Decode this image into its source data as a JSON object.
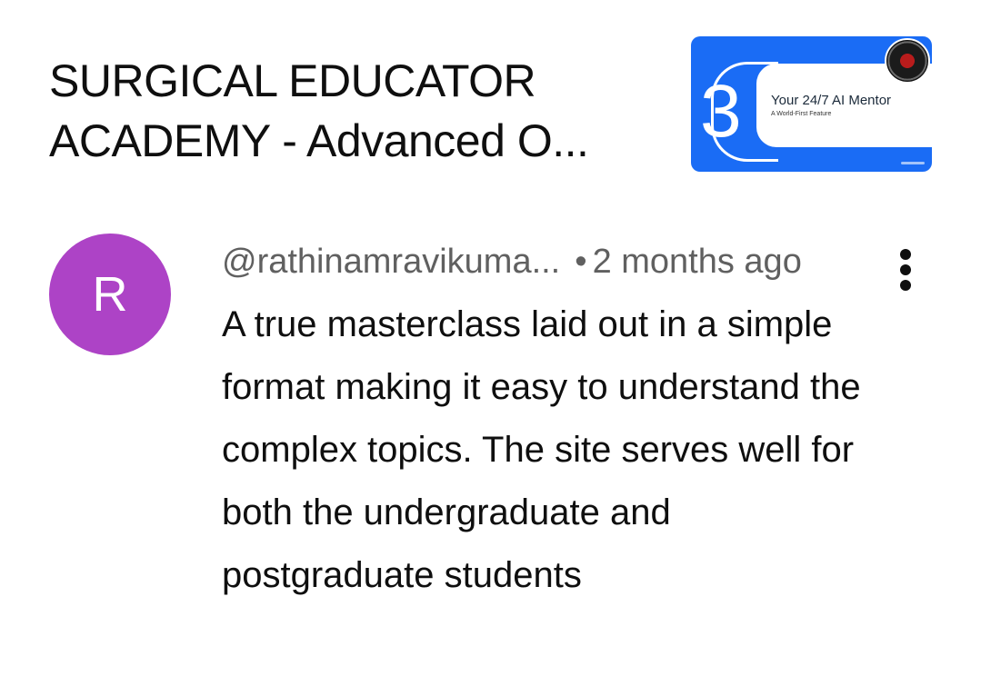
{
  "video": {
    "title": "SURGICAL EDUCATOR ACADEMY - Advanced O...",
    "thumbnail": {
      "number": "3",
      "heading": "Your 24/7 AI Mentor",
      "subheading": "A World-First Feature",
      "background_color": "#1a6cf5"
    }
  },
  "comment": {
    "avatar_letter": "R",
    "avatar_color": "#ad43c6",
    "author": "@rathinamravikuma...",
    "separator": "•",
    "time": "2 months ago",
    "text": "A true masterclass laid out in a simple format making it easy to understand the complex topics. The site serves well for both the undergraduate and postgraduate students",
    "menu_icon": "more-vert-icon"
  }
}
